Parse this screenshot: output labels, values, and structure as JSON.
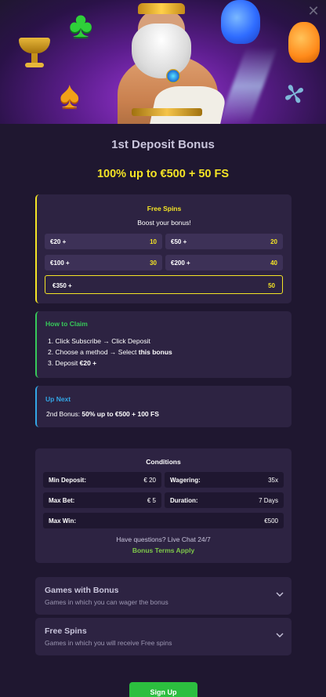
{
  "hero": {
    "close_icon": "close-icon",
    "symbols": [
      "clover-icon",
      "spade-icon",
      "chalice-icon",
      "gummy-bear-blue-icon",
      "gummy-bear-orange-icon",
      "dragonfly-icon",
      "zeus-character"
    ]
  },
  "title": "1st Deposit Bonus",
  "headline": "100% up to €500 + 50 FS",
  "free_spins": {
    "title": "Free Spins",
    "subtitle": "Boost your bonus!",
    "tiers": [
      {
        "amount": "€20 +",
        "spins": "10"
      },
      {
        "amount": "€50 +",
        "spins": "20"
      },
      {
        "amount": "€100 +",
        "spins": "30"
      },
      {
        "amount": "€200 +",
        "spins": "40"
      },
      {
        "amount": "€350 +",
        "spins": "50",
        "selected": true
      }
    ]
  },
  "how_to_claim": {
    "title": "How to Claim",
    "step1": "1. Click Subscribe → Click Deposit",
    "step2_prefix": "2. Choose a method → Select ",
    "step2_bold": "this bonus",
    "step3_prefix": "3. Deposit ",
    "step3_bold": "€20 +"
  },
  "up_next": {
    "title": "Up Next",
    "prefix": "2nd Bonus: ",
    "bold": "50% up to €500 + 100 FS"
  },
  "conditions": {
    "title": "Conditions",
    "min_deposit_label": "Min Deposit:",
    "min_deposit_value": "€ 20",
    "wagering_label": "Wagering:",
    "wagering_value": "35x",
    "max_bet_label": "Max Bet:",
    "max_bet_value": "€ 5",
    "duration_label": "Duration:",
    "duration_value": "7 Days",
    "max_win_label": "Max Win:",
    "max_win_value": "€500",
    "question": "Have questions? Live Chat 24/7",
    "terms_link": "Bonus Terms Apply"
  },
  "accordions": [
    {
      "title": "Games with Bonus",
      "subtitle": "Games in which you can wager the bonus"
    },
    {
      "title": "Free Spins",
      "subtitle": "Games in which you will receive Free spins"
    }
  ],
  "signup_label": "Sign Up",
  "colors": {
    "background": "#1f1730",
    "card": "#2d2342",
    "accent_yellow": "#f4e425",
    "accent_green": "#37c95a",
    "accent_blue": "#33a6e6",
    "signup_green": "#2cbf3f"
  }
}
